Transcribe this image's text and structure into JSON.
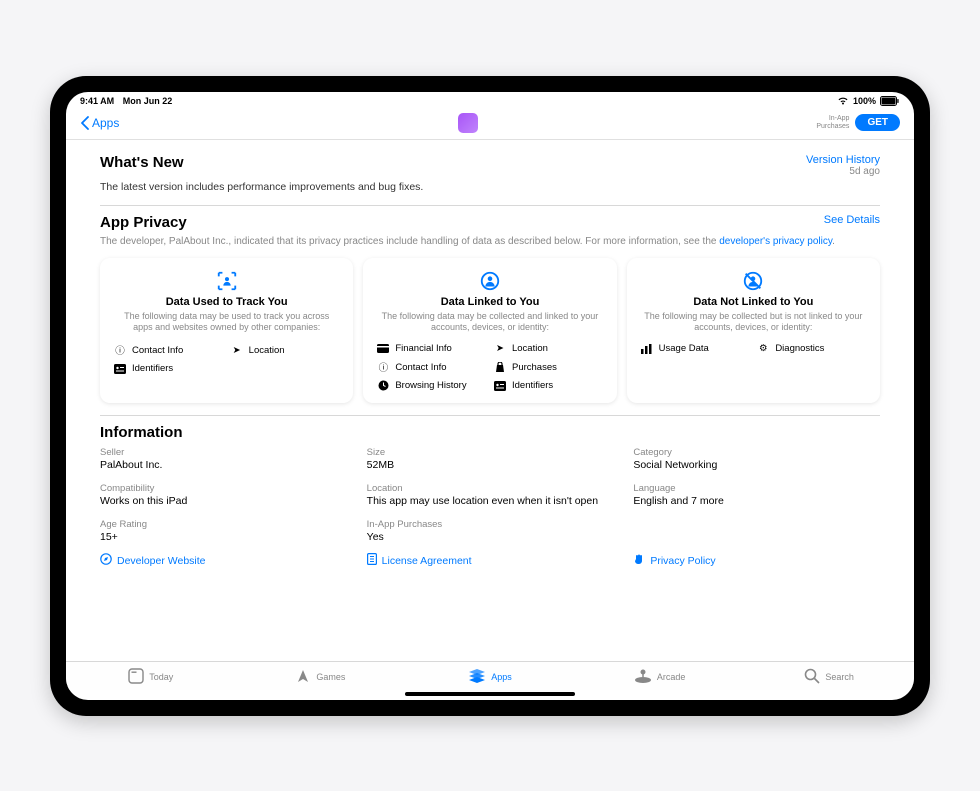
{
  "status": {
    "time": "9:41 AM",
    "date": "Mon Jun 22",
    "battery": "100%"
  },
  "nav": {
    "back_label": "Apps",
    "iap_label": "In-App\nPurchases",
    "get_label": "GET"
  },
  "whats_new": {
    "title": "What's New",
    "desc": "The latest version includes performance improvements and bug fixes.",
    "history_link": "Version History",
    "ago": "5d ago"
  },
  "privacy": {
    "title": "App Privacy",
    "details_link": "See Details",
    "intro_a": "The developer, PalAbout Inc., indicated that its privacy practices include handling of data as described below. For more information, see the ",
    "intro_link": "developer's privacy policy",
    "cards": [
      {
        "title": "Data Used to Track You",
        "sub": "The following data may be used to track you across apps and websites owned by other companies:",
        "items": [
          {
            "icon": "info",
            "label": "Contact Info"
          },
          {
            "icon": "location",
            "label": "Location"
          },
          {
            "icon": "id",
            "label": "Identifiers"
          }
        ]
      },
      {
        "title": "Data Linked to You",
        "sub": "The following data may be collected and linked to your accounts, devices, or identity:",
        "items": [
          {
            "icon": "card",
            "label": "Financial Info"
          },
          {
            "icon": "location",
            "label": "Location"
          },
          {
            "icon": "info",
            "label": "Contact Info"
          },
          {
            "icon": "bag",
            "label": "Purchases"
          },
          {
            "icon": "clock",
            "label": "Browsing History"
          },
          {
            "icon": "id",
            "label": "Identifiers"
          }
        ]
      },
      {
        "title": "Data Not Linked to You",
        "sub": "The following may be collected but is not linked to your accounts, devices, or identity:",
        "items": [
          {
            "icon": "chart",
            "label": "Usage Data"
          },
          {
            "icon": "gear",
            "label": "Diagnostics"
          }
        ]
      }
    ]
  },
  "information": {
    "title": "Information",
    "rows": [
      {
        "label": "Seller",
        "value": "PalAbout Inc."
      },
      {
        "label": "Size",
        "value": "52MB"
      },
      {
        "label": "Category",
        "value": "Social Networking"
      },
      {
        "label": "Compatibility",
        "value": "Works on this iPad"
      },
      {
        "label": "Location",
        "value": "This app may use location even when it isn't open"
      },
      {
        "label": "Language",
        "value": "English and 7 more"
      },
      {
        "label": "Age Rating",
        "value": "15+"
      },
      {
        "label": "In-App Purchases",
        "value": "Yes"
      }
    ],
    "links": [
      {
        "icon": "compass",
        "label": "Developer Website"
      },
      {
        "icon": "doc",
        "label": "License Agreement"
      },
      {
        "icon": "hand",
        "label": "Privacy Policy"
      }
    ]
  },
  "tabs": [
    {
      "icon": "today",
      "label": "Today",
      "active": false
    },
    {
      "icon": "games",
      "label": "Games",
      "active": false
    },
    {
      "icon": "apps",
      "label": "Apps",
      "active": true
    },
    {
      "icon": "arcade",
      "label": "Arcade",
      "active": false
    },
    {
      "icon": "search",
      "label": "Search",
      "active": false
    }
  ]
}
